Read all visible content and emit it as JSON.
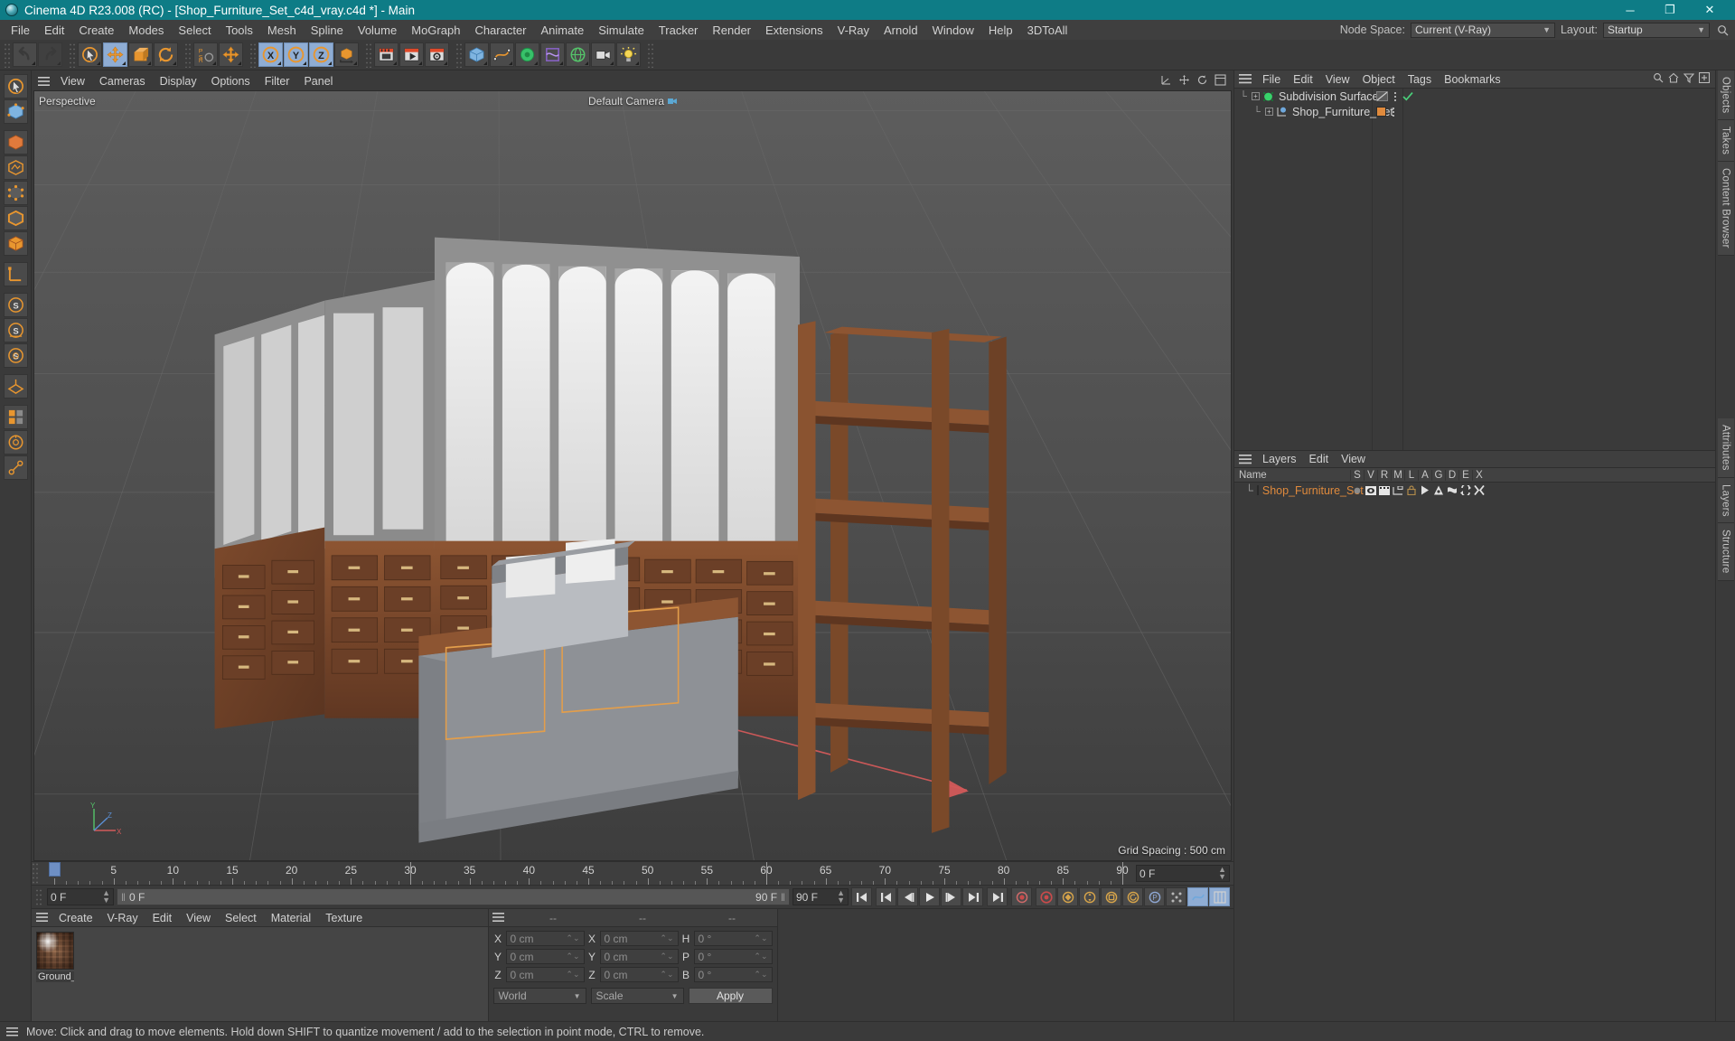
{
  "window": {
    "title": "Cinema 4D R23.008 (RC) - [Shop_Furniture_Set_c4d_vray.c4d *] - Main",
    "minimize": "─",
    "maximize": "❐",
    "close": "✕"
  },
  "menubar": {
    "items": [
      "File",
      "Edit",
      "Create",
      "Modes",
      "Select",
      "Tools",
      "Mesh",
      "Spline",
      "Volume",
      "MoGraph",
      "Character",
      "Animate",
      "Simulate",
      "Tracker",
      "Render",
      "Extensions",
      "V-Ray",
      "Arnold",
      "Window",
      "Help",
      "3DToAll"
    ],
    "node_space_label": "Node Space:",
    "node_space_value": "Current (V-Ray)",
    "layout_label": "Layout:",
    "layout_value": "Startup"
  },
  "toolbar": {
    "groups": [
      {
        "name": "history",
        "buttons": [
          {
            "name": "undo-button",
            "glyph": "undo",
            "state": "normal"
          },
          {
            "name": "redo-button",
            "glyph": "redo",
            "state": "disabled"
          }
        ]
      },
      {
        "name": "transform",
        "buttons": [
          {
            "name": "select-tool-button",
            "glyph": "cursor-circle",
            "state": "normal"
          },
          {
            "name": "move-tool-button",
            "glyph": "move",
            "state": "active"
          },
          {
            "name": "scale-tool-button",
            "glyph": "scale",
            "state": "normal"
          },
          {
            "name": "rotate-tool-button",
            "glyph": "rotate",
            "state": "normal"
          }
        ]
      },
      {
        "name": "psr",
        "buttons": [
          {
            "name": "psr-button",
            "glyph": "psr",
            "state": "normal"
          },
          {
            "name": "world-move-button",
            "glyph": "move",
            "state": "normal"
          }
        ]
      },
      {
        "name": "axis-locks",
        "buttons": [
          {
            "name": "lock-x-button",
            "glyph": "x-axis",
            "state": "active"
          },
          {
            "name": "lock-y-button",
            "glyph": "y-axis",
            "state": "active"
          },
          {
            "name": "lock-z-button",
            "glyph": "z-axis",
            "state": "active"
          },
          {
            "name": "coordinate-system-button",
            "glyph": "world-cube",
            "state": "normal"
          }
        ]
      },
      {
        "name": "render",
        "buttons": [
          {
            "name": "render-view-button",
            "glyph": "render-view",
            "state": "normal"
          },
          {
            "name": "render-to-picture-viewer-button",
            "glyph": "render-picture",
            "state": "normal"
          },
          {
            "name": "render-settings-button",
            "glyph": "render-settings",
            "state": "normal"
          }
        ]
      },
      {
        "name": "primitives",
        "buttons": [
          {
            "name": "add-cube-button",
            "glyph": "cube",
            "state": "normal"
          },
          {
            "name": "add-spline-button",
            "glyph": "spline",
            "state": "normal"
          },
          {
            "name": "add-generator-button",
            "glyph": "generator",
            "state": "normal"
          },
          {
            "name": "add-deformer-button",
            "glyph": "deformer",
            "state": "normal"
          },
          {
            "name": "add-environment-button",
            "glyph": "environment",
            "state": "normal"
          },
          {
            "name": "add-camera-button",
            "glyph": "camera",
            "state": "normal"
          },
          {
            "name": "add-light-button",
            "glyph": "light",
            "state": "normal"
          }
        ]
      }
    ]
  },
  "leftbar": {
    "buttons": [
      {
        "name": "live-selection-tool",
        "glyph": "cursor-circle"
      },
      {
        "name": "make-editable-tool",
        "glyph": "editable"
      },
      {
        "name": "model-mode-tool",
        "glyph": "model"
      },
      {
        "name": "texture-mode-tool",
        "glyph": "texture"
      },
      {
        "name": "points-mode-tool",
        "glyph": "points"
      },
      {
        "name": "edges-mode-tool",
        "glyph": "edges"
      },
      {
        "name": "polygons-mode-tool",
        "glyph": "polygons"
      },
      {
        "name": "enable-axis-tool",
        "glyph": "axis"
      },
      {
        "name": "viewport-solo-single-tool",
        "glyph": "solo-s"
      },
      {
        "name": "viewport-solo-hierarchy-tool",
        "glyph": "solo-s2"
      },
      {
        "name": "viewport-solo-off-tool",
        "glyph": "solo-s3"
      },
      {
        "name": "workplane-tool",
        "glyph": "workplane"
      },
      {
        "name": "snap-tool",
        "glyph": "snap"
      },
      {
        "name": "quantize-tool",
        "glyph": "quantize"
      },
      {
        "name": "kinematics-tool",
        "glyph": "kinematics"
      }
    ]
  },
  "viewport": {
    "menu": [
      "View",
      "Cameras",
      "Display",
      "Options",
      "Filter",
      "Panel"
    ],
    "projection_label": "Perspective",
    "camera_label": "Default Camera",
    "grid_spacing_label": "Grid Spacing : 500 cm",
    "axis_gizmo": {
      "y": "Y",
      "x": "X",
      "z": "Z"
    }
  },
  "timeline": {
    "start": 0,
    "end": 90,
    "major_ticks": [
      0,
      5,
      10,
      15,
      20,
      25,
      30,
      35,
      40,
      45,
      50,
      55,
      60,
      65,
      70,
      75,
      80,
      85,
      90
    ],
    "playhead_frame": 0,
    "current_frame_right": "0 F"
  },
  "transport": {
    "current_frame": "0 F",
    "range_start": "0 F",
    "range_end": "90 F",
    "preview_end": "90 F",
    "buttons": [
      {
        "name": "go-to-start-button",
        "glyph": "skip-start"
      },
      {
        "name": "go-to-previous-key-button",
        "glyph": "prev-key"
      },
      {
        "name": "step-back-button",
        "glyph": "step-back"
      },
      {
        "name": "play-button",
        "glyph": "play"
      },
      {
        "name": "step-forward-button",
        "glyph": "step-fwd"
      },
      {
        "name": "go-to-next-key-button",
        "glyph": "next-key"
      },
      {
        "name": "go-to-end-button",
        "glyph": "skip-end"
      },
      {
        "name": "record-active-objects-button",
        "glyph": "record"
      },
      {
        "name": "autokeying-button",
        "glyph": "autokey"
      },
      {
        "name": "keyframe-selection-button",
        "glyph": "key-sel"
      },
      {
        "name": "position-key-button",
        "glyph": "key-p"
      },
      {
        "name": "scale-key-button",
        "glyph": "key-s"
      },
      {
        "name": "rotation-key-button",
        "glyph": "key-r"
      },
      {
        "name": "parameter-key-button",
        "glyph": "key-param"
      },
      {
        "name": "point-level-animation-button",
        "glyph": "pla"
      },
      {
        "name": "motion-clip-button",
        "glyph": "motion"
      },
      {
        "name": "timeline-toggle-button",
        "glyph": "tl-toggle"
      }
    ]
  },
  "material_manager": {
    "menu": [
      "Create",
      "V-Ray",
      "Edit",
      "View",
      "Select",
      "Material",
      "Texture"
    ],
    "materials": [
      {
        "name": "Ground_"
      }
    ]
  },
  "coordinates": {
    "header": [
      "--",
      "--",
      "--"
    ],
    "rows": [
      {
        "axis1": "X",
        "value1": "0 cm",
        "axis2": "X",
        "value2": "0 cm",
        "axis3": "H",
        "value3": "0 °"
      },
      {
        "axis1": "Y",
        "value1": "0 cm",
        "axis2": "Y",
        "value2": "0 cm",
        "axis3": "P",
        "value3": "0 °"
      },
      {
        "axis1": "Z",
        "value1": "0 cm",
        "axis2": "Z",
        "value2": "0 cm",
        "axis3": "B",
        "value3": "0 °"
      }
    ],
    "system": "World",
    "mode": "Scale",
    "apply": "Apply"
  },
  "object_manager": {
    "menu": [
      "File",
      "Edit",
      "View",
      "Object",
      "Tags",
      "Bookmarks"
    ],
    "tree": [
      {
        "name": "Subdivision Surface",
        "indent": 0,
        "icon_color": "#37d36a",
        "tag_kind": "checkmark",
        "selected": false
      },
      {
        "name": "Shop_Furniture_Set",
        "indent": 1,
        "icon_color": "#6fa8dc",
        "tag_kind": "layer",
        "swatch": "#e08a3c",
        "selected": false
      }
    ]
  },
  "layer_manager": {
    "menu": [
      "Layers",
      "Edit",
      "View"
    ],
    "columns": [
      "Name",
      "S",
      "V",
      "R",
      "M",
      "L",
      "A",
      "G",
      "D",
      "E",
      "X"
    ],
    "rows": [
      {
        "name": "Shop_Furniture_Set",
        "color": "#e08a3c"
      }
    ]
  },
  "right_dock_tabs": [
    "Objects",
    "Takes",
    "Content Browser"
  ],
  "right_dock_tabs_lower": [
    "Attributes",
    "Layers",
    "Structure"
  ],
  "statusbar": {
    "message": "Move: Click and drag to move elements. Hold down SHIFT to quantize movement / add to the selection in point mode, CTRL to remove."
  },
  "colors": {
    "title_bar": "#0e7c86",
    "accent_orange": "#e08a3c",
    "active_blue": "#8fadd4",
    "panel_bg": "#3a3a3a"
  }
}
